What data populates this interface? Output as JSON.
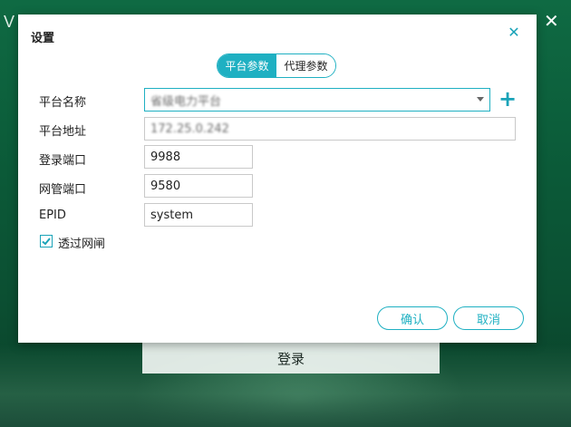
{
  "background": {
    "letter": "V",
    "close_glyph": "✕",
    "login_label": "登录"
  },
  "dialog": {
    "title": "设置",
    "close_glyph": "✕",
    "tabs": [
      {
        "label": "平台参数",
        "active": true
      },
      {
        "label": "代理参数",
        "active": false
      }
    ],
    "fields": {
      "platform_name": {
        "label": "平台名称",
        "value": "省级电力平台"
      },
      "platform_address": {
        "label": "平台地址",
        "value": "172.25.0.242"
      },
      "login_port": {
        "label": "登录端口",
        "value": "9988"
      },
      "manage_port": {
        "label": "网管端口",
        "value": "9580"
      },
      "epid": {
        "label": "EPID",
        "value": "system"
      }
    },
    "add_glyph": "+",
    "checkbox": {
      "label": "透过网闸",
      "checked": true
    },
    "buttons": {
      "confirm": "确认",
      "cancel": "取消"
    }
  },
  "colors": {
    "accent": "#1fb0c2",
    "background_green": "#0b5a38"
  },
  "icons": [
    "close-icon",
    "dropdown-chevron-icon",
    "add-icon",
    "check-icon"
  ]
}
